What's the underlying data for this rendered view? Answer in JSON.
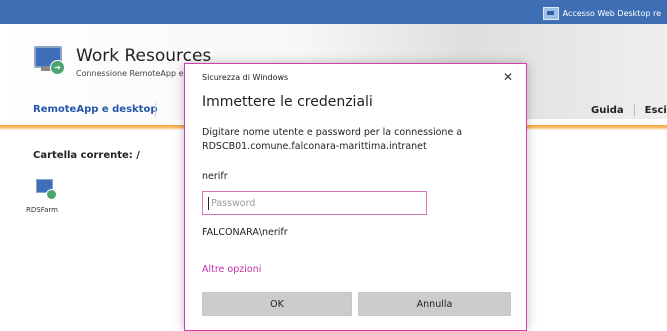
{
  "topbar": {
    "link_label": "Accesso Web Desktop re"
  },
  "header": {
    "title": "Work Resources",
    "subtitle": "Connessione RemoteApp e",
    "nav_left": "RemoteApp e desktop",
    "nav_right": [
      "Guida",
      "Esci"
    ]
  },
  "folder": {
    "label": "Cartella corrente: /"
  },
  "resources": [
    {
      "label": "RDSFarm",
      "icon": "remote-desktop-icon"
    }
  ],
  "dialog": {
    "caption": "Sicurezza di Windows",
    "close_glyph": "✕",
    "heading": "Immettere le credenziali",
    "message": "Digitare nome utente e password per la connessione a RDSCB01.comune.falconara-marittima.intranet",
    "username": "nerifr",
    "password_placeholder": "Password",
    "password_value": "",
    "domain_user": "FALCONARA\\nerifr",
    "more_options": "Altre opzioni",
    "ok_label": "OK",
    "cancel_label": "Annulla"
  },
  "colors": {
    "topbar": "#3e6fb5",
    "accent_orange": "#f6a23a",
    "dialog_border": "#d43dac",
    "link_magenta": "#c42fa9",
    "nav_blue": "#2358a8"
  }
}
